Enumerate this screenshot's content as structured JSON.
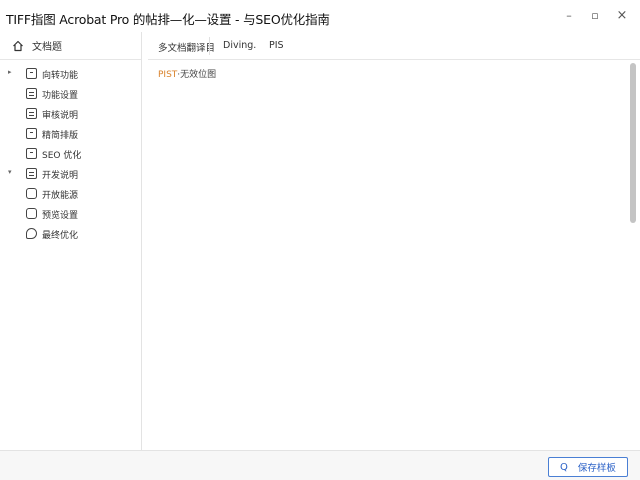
{
  "window": {
    "title": "TIFF指图 Acrobat Pro 的帖排—化—设置 - 与SEO优化指南",
    "min_glyph": "–",
    "max_glyph": "▫",
    "close_glyph": "×"
  },
  "sidebar": {
    "header_icon": "home-icon",
    "header_label": "文档题",
    "items": [
      {
        "arrow": "▸",
        "icon": "doc-icon",
        "label": "向转功能"
      },
      {
        "arrow": "",
        "icon": "list-icon",
        "label": "功能设置"
      },
      {
        "arrow": "",
        "icon": "list-icon",
        "label": "审核说明"
      },
      {
        "arrow": "",
        "icon": "doc-icon",
        "label": "精简排版"
      },
      {
        "arrow": "",
        "icon": "doc-icon",
        "label": "SEO 优化"
      },
      {
        "arrow": "▾",
        "icon": "list-icon",
        "label": "开发说明"
      },
      {
        "arrow": "",
        "icon": "card-icon",
        "label": "开放能源"
      },
      {
        "arrow": "",
        "icon": "card-icon",
        "label": "预览设置"
      },
      {
        "arrow": "",
        "icon": "leaf-icon",
        "label": "最终优化"
      }
    ]
  },
  "toolbar": {
    "items": [
      "多文档翻译目",
      "Diving.",
      "PIS"
    ]
  },
  "content": {
    "line_highlight": "PIST",
    "line_rest": "·无效位图"
  },
  "footer": {
    "button_icon": "search-icon",
    "button_glyph": "Q",
    "button_label": "保存样板"
  },
  "colors": {
    "accent": "#2c62c7",
    "highlight": "#d9822b",
    "border": "#e3e3e3",
    "scroll_thumb": "#c4c4c4"
  }
}
